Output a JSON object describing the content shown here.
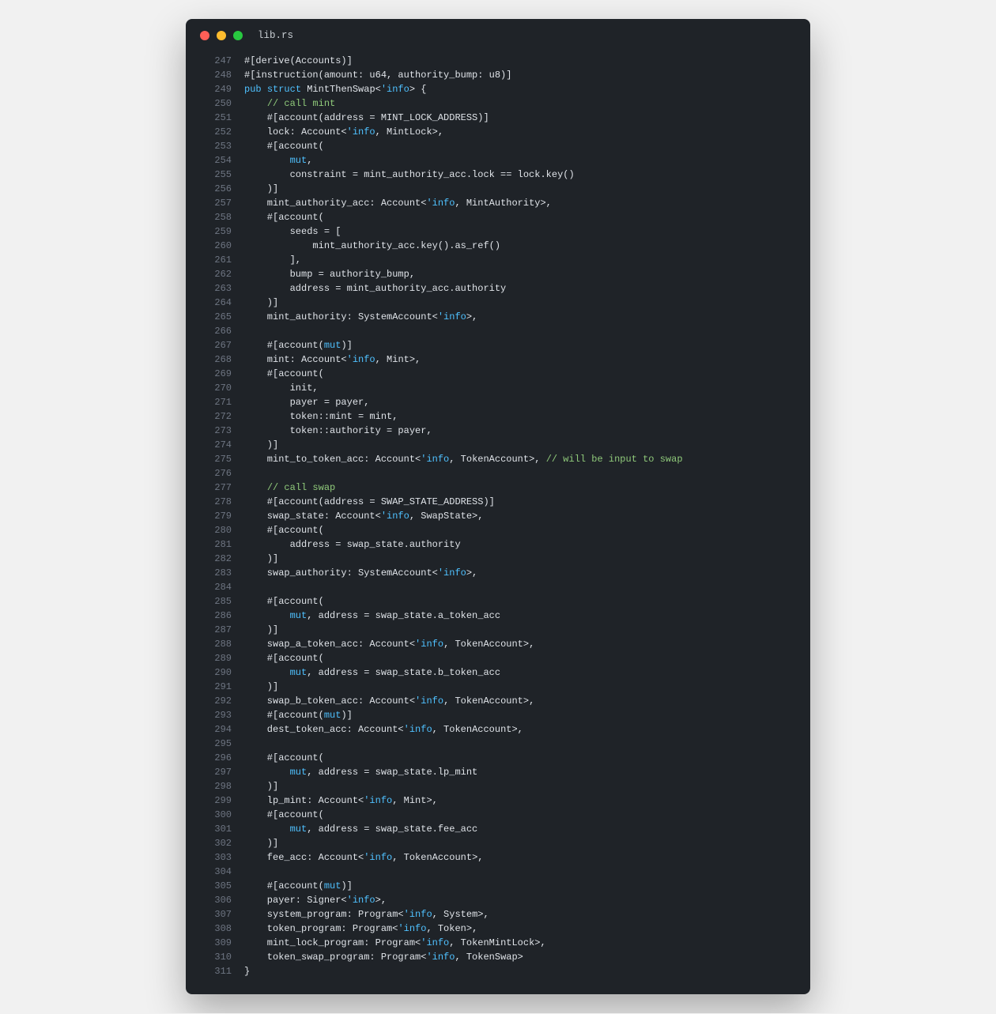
{
  "window": {
    "filename": "lib.rs"
  },
  "lines": [
    {
      "n": 247,
      "seg": [
        [
          "plain",
          "#[derive(Accounts)]"
        ]
      ]
    },
    {
      "n": 248,
      "seg": [
        [
          "plain",
          "#[instruction(amount: u64, authority_bump: u8)]"
        ]
      ]
    },
    {
      "n": 249,
      "seg": [
        [
          "kw",
          "pub"
        ],
        [
          "plain",
          " "
        ],
        [
          "kw",
          "struct"
        ],
        [
          "plain",
          " MintThenSwap<"
        ],
        [
          "life",
          "'info"
        ],
        [
          "plain",
          "> {"
        ]
      ]
    },
    {
      "n": 250,
      "seg": [
        [
          "plain",
          "    "
        ],
        [
          "cmt",
          "// call mint"
        ]
      ]
    },
    {
      "n": 251,
      "seg": [
        [
          "plain",
          "    #[account(address = MINT_LOCK_ADDRESS)]"
        ]
      ]
    },
    {
      "n": 252,
      "seg": [
        [
          "plain",
          "    lock: Account<"
        ],
        [
          "life",
          "'info"
        ],
        [
          "plain",
          ", MintLock>,"
        ]
      ]
    },
    {
      "n": 253,
      "seg": [
        [
          "plain",
          "    #[account("
        ]
      ]
    },
    {
      "n": 254,
      "seg": [
        [
          "plain",
          "        "
        ],
        [
          "mut",
          "mut"
        ],
        [
          "plain",
          ","
        ]
      ]
    },
    {
      "n": 255,
      "seg": [
        [
          "plain",
          "        constraint = mint_authority_acc.lock == lock.key()"
        ]
      ]
    },
    {
      "n": 256,
      "seg": [
        [
          "plain",
          "    )]"
        ]
      ]
    },
    {
      "n": 257,
      "seg": [
        [
          "plain",
          "    mint_authority_acc: Account<"
        ],
        [
          "life",
          "'info"
        ],
        [
          "plain",
          ", MintAuthority>,"
        ]
      ]
    },
    {
      "n": 258,
      "seg": [
        [
          "plain",
          "    #[account("
        ]
      ]
    },
    {
      "n": 259,
      "seg": [
        [
          "plain",
          "        seeds = ["
        ]
      ]
    },
    {
      "n": 260,
      "seg": [
        [
          "plain",
          "            mint_authority_acc.key().as_ref()"
        ]
      ]
    },
    {
      "n": 261,
      "seg": [
        [
          "plain",
          "        ],"
        ]
      ]
    },
    {
      "n": 262,
      "seg": [
        [
          "plain",
          "        bump = authority_bump,"
        ]
      ]
    },
    {
      "n": 263,
      "seg": [
        [
          "plain",
          "        address = mint_authority_acc.authority"
        ]
      ]
    },
    {
      "n": 264,
      "seg": [
        [
          "plain",
          "    )]"
        ]
      ]
    },
    {
      "n": 265,
      "seg": [
        [
          "plain",
          "    mint_authority: SystemAccount<"
        ],
        [
          "life",
          "'info"
        ],
        [
          "plain",
          ">,"
        ]
      ]
    },
    {
      "n": 266,
      "seg": [
        [
          "plain",
          ""
        ]
      ]
    },
    {
      "n": 267,
      "seg": [
        [
          "plain",
          "    #[account("
        ],
        [
          "mut",
          "mut"
        ],
        [
          "plain",
          ")]"
        ]
      ]
    },
    {
      "n": 268,
      "seg": [
        [
          "plain",
          "    mint: Account<"
        ],
        [
          "life",
          "'info"
        ],
        [
          "plain",
          ", Mint>,"
        ]
      ]
    },
    {
      "n": 269,
      "seg": [
        [
          "plain",
          "    #[account("
        ]
      ]
    },
    {
      "n": 270,
      "seg": [
        [
          "plain",
          "        init,"
        ]
      ]
    },
    {
      "n": 271,
      "seg": [
        [
          "plain",
          "        payer = payer,"
        ]
      ]
    },
    {
      "n": 272,
      "seg": [
        [
          "plain",
          "        token::mint = mint,"
        ]
      ]
    },
    {
      "n": 273,
      "seg": [
        [
          "plain",
          "        token::authority = payer,"
        ]
      ]
    },
    {
      "n": 274,
      "seg": [
        [
          "plain",
          "    )]"
        ]
      ]
    },
    {
      "n": 275,
      "seg": [
        [
          "plain",
          "    mint_to_token_acc: Account<"
        ],
        [
          "life",
          "'info"
        ],
        [
          "plain",
          ", TokenAccount>, "
        ],
        [
          "cmt",
          "// will be input to swap"
        ]
      ]
    },
    {
      "n": 276,
      "seg": [
        [
          "plain",
          ""
        ]
      ]
    },
    {
      "n": 277,
      "seg": [
        [
          "plain",
          "    "
        ],
        [
          "cmt",
          "// call swap"
        ]
      ]
    },
    {
      "n": 278,
      "seg": [
        [
          "plain",
          "    #[account(address = SWAP_STATE_ADDRESS)]"
        ]
      ]
    },
    {
      "n": 279,
      "seg": [
        [
          "plain",
          "    swap_state: Account<"
        ],
        [
          "life",
          "'info"
        ],
        [
          "plain",
          ", SwapState>,"
        ]
      ]
    },
    {
      "n": 280,
      "seg": [
        [
          "plain",
          "    #[account("
        ]
      ]
    },
    {
      "n": 281,
      "seg": [
        [
          "plain",
          "        address = swap_state.authority"
        ]
      ]
    },
    {
      "n": 282,
      "seg": [
        [
          "plain",
          "    )]"
        ]
      ]
    },
    {
      "n": 283,
      "seg": [
        [
          "plain",
          "    swap_authority: SystemAccount<"
        ],
        [
          "life",
          "'info"
        ],
        [
          "plain",
          ">,"
        ]
      ]
    },
    {
      "n": 284,
      "seg": [
        [
          "plain",
          ""
        ]
      ]
    },
    {
      "n": 285,
      "seg": [
        [
          "plain",
          "    #[account("
        ]
      ]
    },
    {
      "n": 286,
      "seg": [
        [
          "plain",
          "        "
        ],
        [
          "mut",
          "mut"
        ],
        [
          "plain",
          ", address = swap_state.a_token_acc"
        ]
      ]
    },
    {
      "n": 287,
      "seg": [
        [
          "plain",
          "    )]"
        ]
      ]
    },
    {
      "n": 288,
      "seg": [
        [
          "plain",
          "    swap_a_token_acc: Account<"
        ],
        [
          "life",
          "'info"
        ],
        [
          "plain",
          ", TokenAccount>,"
        ]
      ]
    },
    {
      "n": 289,
      "seg": [
        [
          "plain",
          "    #[account("
        ]
      ]
    },
    {
      "n": 290,
      "seg": [
        [
          "plain",
          "        "
        ],
        [
          "mut",
          "mut"
        ],
        [
          "plain",
          ", address = swap_state.b_token_acc"
        ]
      ]
    },
    {
      "n": 291,
      "seg": [
        [
          "plain",
          "    )]"
        ]
      ]
    },
    {
      "n": 292,
      "seg": [
        [
          "plain",
          "    swap_b_token_acc: Account<"
        ],
        [
          "life",
          "'info"
        ],
        [
          "plain",
          ", TokenAccount>,"
        ]
      ]
    },
    {
      "n": 293,
      "seg": [
        [
          "plain",
          "    #[account("
        ],
        [
          "mut",
          "mut"
        ],
        [
          "plain",
          ")]"
        ]
      ]
    },
    {
      "n": 294,
      "seg": [
        [
          "plain",
          "    dest_token_acc: Account<"
        ],
        [
          "life",
          "'info"
        ],
        [
          "plain",
          ", TokenAccount>,"
        ]
      ]
    },
    {
      "n": 295,
      "seg": [
        [
          "plain",
          ""
        ]
      ]
    },
    {
      "n": 296,
      "seg": [
        [
          "plain",
          "    #[account("
        ]
      ]
    },
    {
      "n": 297,
      "seg": [
        [
          "plain",
          "        "
        ],
        [
          "mut",
          "mut"
        ],
        [
          "plain",
          ", address = swap_state.lp_mint"
        ]
      ]
    },
    {
      "n": 298,
      "seg": [
        [
          "plain",
          "    )]"
        ]
      ]
    },
    {
      "n": 299,
      "seg": [
        [
          "plain",
          "    lp_mint: Account<"
        ],
        [
          "life",
          "'info"
        ],
        [
          "plain",
          ", Mint>,"
        ]
      ]
    },
    {
      "n": 300,
      "seg": [
        [
          "plain",
          "    #[account("
        ]
      ]
    },
    {
      "n": 301,
      "seg": [
        [
          "plain",
          "        "
        ],
        [
          "mut",
          "mut"
        ],
        [
          "plain",
          ", address = swap_state.fee_acc"
        ]
      ]
    },
    {
      "n": 302,
      "seg": [
        [
          "plain",
          "    )]"
        ]
      ]
    },
    {
      "n": 303,
      "seg": [
        [
          "plain",
          "    fee_acc: Account<"
        ],
        [
          "life",
          "'info"
        ],
        [
          "plain",
          ", TokenAccount>,"
        ]
      ]
    },
    {
      "n": 304,
      "seg": [
        [
          "plain",
          ""
        ]
      ]
    },
    {
      "n": 305,
      "seg": [
        [
          "plain",
          "    #[account("
        ],
        [
          "mut",
          "mut"
        ],
        [
          "plain",
          ")]"
        ]
      ]
    },
    {
      "n": 306,
      "seg": [
        [
          "plain",
          "    payer: Signer<"
        ],
        [
          "life",
          "'info"
        ],
        [
          "plain",
          ">,"
        ]
      ]
    },
    {
      "n": 307,
      "seg": [
        [
          "plain",
          "    system_program: Program<"
        ],
        [
          "life",
          "'info"
        ],
        [
          "plain",
          ", System>,"
        ]
      ]
    },
    {
      "n": 308,
      "seg": [
        [
          "plain",
          "    token_program: Program<"
        ],
        [
          "life",
          "'info"
        ],
        [
          "plain",
          ", Token>,"
        ]
      ]
    },
    {
      "n": 309,
      "seg": [
        [
          "plain",
          "    mint_lock_program: Program<"
        ],
        [
          "life",
          "'info"
        ],
        [
          "plain",
          ", TokenMintLock>,"
        ]
      ]
    },
    {
      "n": 310,
      "seg": [
        [
          "plain",
          "    token_swap_program: Program<"
        ],
        [
          "life",
          "'info"
        ],
        [
          "plain",
          ", TokenSwap>"
        ]
      ]
    },
    {
      "n": 311,
      "seg": [
        [
          "plain",
          "}"
        ]
      ]
    }
  ]
}
